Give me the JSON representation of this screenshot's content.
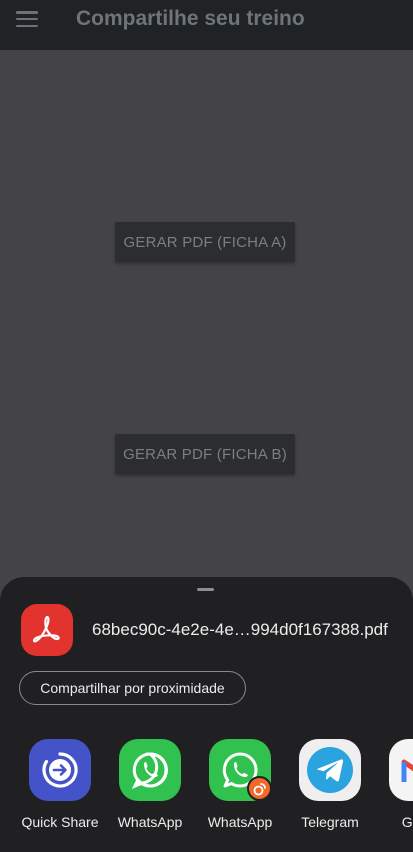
{
  "app_bar": {
    "title": "Compartilhe seu treino"
  },
  "buttons": {
    "pdf_a": "GERAR PDF (FICHA A)",
    "pdf_b": "GERAR PDF (FICHA B)"
  },
  "share_sheet": {
    "file_name": "68bec90c-4e2e-4e…994d0f167388.pdf",
    "file_icon": "pdf-icon",
    "nearby_label": "Compartilhar por proximidade",
    "apps": [
      {
        "label": "Quick Share",
        "icon": "quick-share-icon",
        "color": "#4454c8"
      },
      {
        "label": "WhatsApp",
        "icon": "whatsapp-icon",
        "color": "#31c14f"
      },
      {
        "label": "WhatsApp",
        "icon": "whatsapp-dual-icon",
        "color": "#31c14f"
      },
      {
        "label": "Telegram",
        "icon": "telegram-icon",
        "color": "#2aa3df"
      },
      {
        "label": "Gmail",
        "icon": "gmail-icon",
        "color": "#ea4335"
      }
    ]
  }
}
